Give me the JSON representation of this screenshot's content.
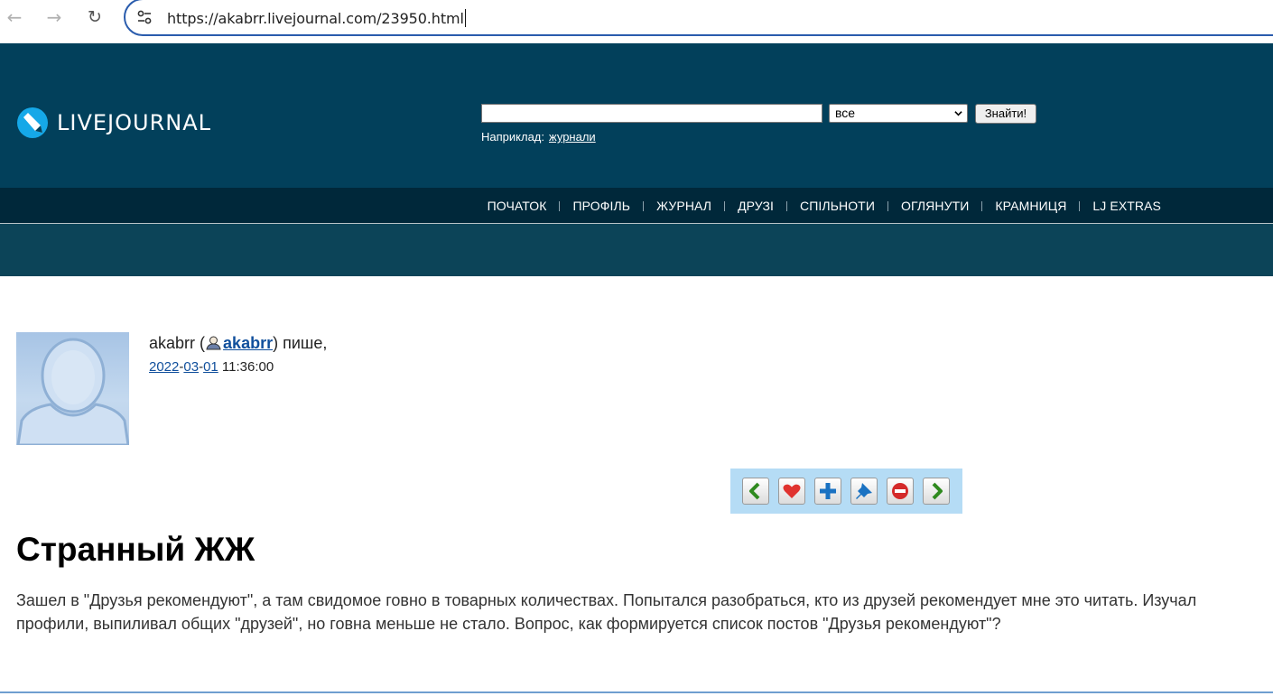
{
  "browser": {
    "url": "https://akabrr.livejournal.com/23950.html",
    "icons": [
      "back-arrow-icon",
      "forward-arrow-icon",
      "reload-icon",
      "site-info-icon"
    ]
  },
  "header": {
    "logo_text": "LIVEJOURNAL",
    "search": {
      "value": "",
      "scope_selected": "все",
      "button_label": "Знайти!"
    },
    "example_label": "Наприклад:",
    "example_link": "журнали",
    "colors": {
      "header_bg": "#02405b",
      "nav_bg": "#00283a",
      "band_bg": "#0c4458"
    }
  },
  "nav": {
    "items": [
      "ПОЧАТОК",
      "ПРОФІЛЬ",
      "ЖУРНАЛ",
      "ДРУЗІ",
      "СПІЛЬНОТИ",
      "ОГЛЯНУТИ",
      "КРАМНИЦЯ",
      "LJ EXTRAS"
    ]
  },
  "entry": {
    "author_name": "akabrr",
    "paren_open": "(",
    "username": "akabrr",
    "paren_close_writes": ") пише,",
    "date": {
      "year": "2022",
      "month": "03",
      "day": "01",
      "dash": "-",
      "time": "11:36:00"
    },
    "actions": [
      "prev-arrow-icon",
      "heart-icon",
      "plus-icon",
      "pin-icon",
      "no-entry-icon",
      "next-arrow-icon"
    ],
    "title": "Странный ЖЖ",
    "body": "Зашел в \"Друзья рекомендуют\", а там свидомое говно в товарных количествах. Попытался разобраться, кто из друзей рекомендует мне это читать. Изучал профили, выпиливал общих \"друзей\", но говна меньше не стало. Вопрос, как формируется список постов \"Друзья рекомендуют\"?"
  }
}
